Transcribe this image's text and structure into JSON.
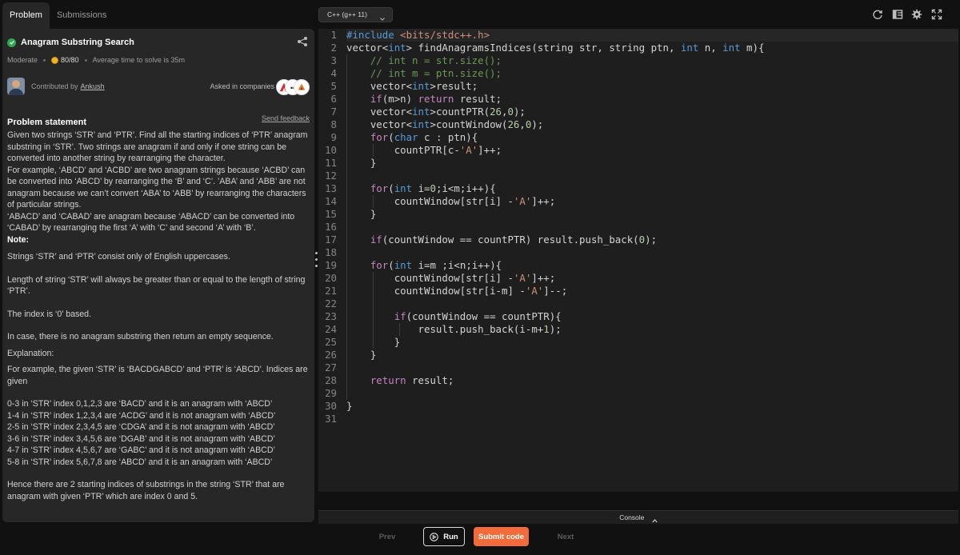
{
  "tabs": [
    {
      "label": "Problem",
      "active": true
    },
    {
      "label": "Submissions",
      "active": false
    }
  ],
  "problem": {
    "title": "Anagram Substring Search",
    "difficulty": "Moderate",
    "score": "80/80",
    "avg_time": "Average time to solve is 35m",
    "contributed_by_label": "Contributed by",
    "contributor": "Ankush",
    "asked_in_label": "Asked in companies",
    "statement_heading": "Problem statement",
    "feedback_label": "Send feedback",
    "statement": [
      {
        "text": "Given two strings ‘STR’ and ‘PTR’. Find all the starting indices of ‘PTR’ anagram",
        "bold": false
      },
      {
        "text": "substring in ‘STR’. Two strings are anagram if and only if one string can be",
        "bold": false
      },
      {
        "text": "converted into another string by rearranging the character.",
        "bold": false
      },
      {
        "text": "For example, ‘ABCD’ and ‘ACBD’ are two anagram strings because ‘ACBD’ can",
        "bold": false
      },
      {
        "text": "be converted into ‘ABCD’ by rearranging the ‘B’ and ‘C’. ’ABA’ and ‘ABB’ are not",
        "bold": false
      },
      {
        "text": "anagram because we can’t convert ‘ABA’ to ‘ABB’ by rearranging the characters",
        "bold": false
      },
      {
        "text": "of particular strings.",
        "bold": false
      },
      {
        "text": "‘ABACD’ and ‘CABAD’ are anagram because ‘ABACD’ can be converted into",
        "bold": false
      },
      {
        "text": "‘CABAD’ by rearranging the first ‘A’ with ‘C’ and second ‘A’ with ‘B’.",
        "bold": false
      },
      {
        "text": "Note:",
        "bold": true
      },
      {
        "text": "Strings ‘STR’ and ‘PTR’ consist only of English uppercases.",
        "bold": false,
        "gap": true
      },
      {
        "text": "Length of string ‘STR’ will always be greater than or equal to the length of string",
        "bold": false,
        "gap": true
      },
      {
        "text": "‘PTR’.",
        "bold": false
      },
      {
        "text": "The index is ‘0’ based.",
        "bold": false,
        "gap": true
      },
      {
        "text": "In case, there is no anagram substring then return an empty sequence.",
        "bold": false,
        "gap": true
      },
      {
        "text": "Explanation:",
        "bold": false,
        "gap": true,
        "small_gap": true
      },
      {
        "text": "For example, the given ‘STR’ is ‘BACDGABCD’ and ‘PTR’ is ‘ABCD’. Indices are",
        "bold": false,
        "small_gap": true
      },
      {
        "text": "given",
        "bold": false
      },
      {
        "text": "0-3 in ‘STR’ index 0,1,2,3 are ‘BACD’ and it is an anagram with ‘ABCD’",
        "bold": false,
        "gap": true
      },
      {
        "text": "1-4 in ‘STR’ index 1,2,3,4 are ‘ACDG’ and it is not anagram with ‘ABCD’",
        "bold": false
      },
      {
        "text": "2-5 in ‘STR’ index 2,3,4,5 are ‘CDGA’ and it is not anagram with ‘ABCD’",
        "bold": false
      },
      {
        "text": "3-6 in ‘STR’ index 3,4,5,6 are ‘DGAB’ and it is not anagram with ‘ABCD’",
        "bold": false
      },
      {
        "text": "4-7 in ‘STR’ index 4,5,6,7 are ‘GABC’ and it is not anagram with ‘ABCD’",
        "bold": false
      },
      {
        "text": "5-8 in ‘STR’ index 5,6,7,8 are ‘ABCD’ and it is an anagram with ‘ABCD’",
        "bold": false
      },
      {
        "text": "Hence there are 2 starting indices of substrings in the string ‘STR’ that are",
        "bold": false,
        "gap": true
      },
      {
        "text": "anagram with given ‘PTR’  which are index 0 and 5.",
        "bold": false
      }
    ]
  },
  "editor": {
    "language": "C++ (g++ 11)",
    "icons": [
      "refresh-icon",
      "layout-icon",
      "settings-icon",
      "fullscreen-icon"
    ],
    "code": [
      "#include <bits/stdc++.h>",
      "vector<int> findAnagramsIndices(string str, string ptn, int n, int m){",
      "    // int n = str.size();",
      "    // int m = ptn.size();",
      "    vector<int>result;",
      "    if(m>n) return result;",
      "    vector<int>countPTR(26,0);",
      "    vector<int>countWindow(26,0);",
      "    for(char c : ptn){",
      "        countPTR[c-'A']++;",
      "    }",
      "",
      "    for(int i=0;i<m;i++){",
      "        countWindow[str[i] -'A']++;",
      "    }",
      "",
      "    if(countWindow == countPTR) result.push_back(0);",
      "",
      "    for(int i=m ;i<n;i++){",
      "        countWindow[str[i] -'A']++;",
      "        countWindow[str[i-m] -'A']--;",
      "",
      "        if(countWindow == countPTR){",
      "            result.push_back(i-m+1);",
      "        }",
      "    }",
      "",
      "    return result;",
      "",
      "}",
      ""
    ]
  },
  "console": {
    "label": "Console"
  },
  "actions": {
    "prev": "Prev",
    "run": "Run",
    "submit": "Submit code",
    "next": "Next"
  },
  "colors": {
    "accent": "#f26b3a",
    "success": "#2fa84f",
    "keyword": "#569cd6",
    "string": "#ce9178",
    "number": "#b5cea8",
    "comment": "#6a9955"
  }
}
